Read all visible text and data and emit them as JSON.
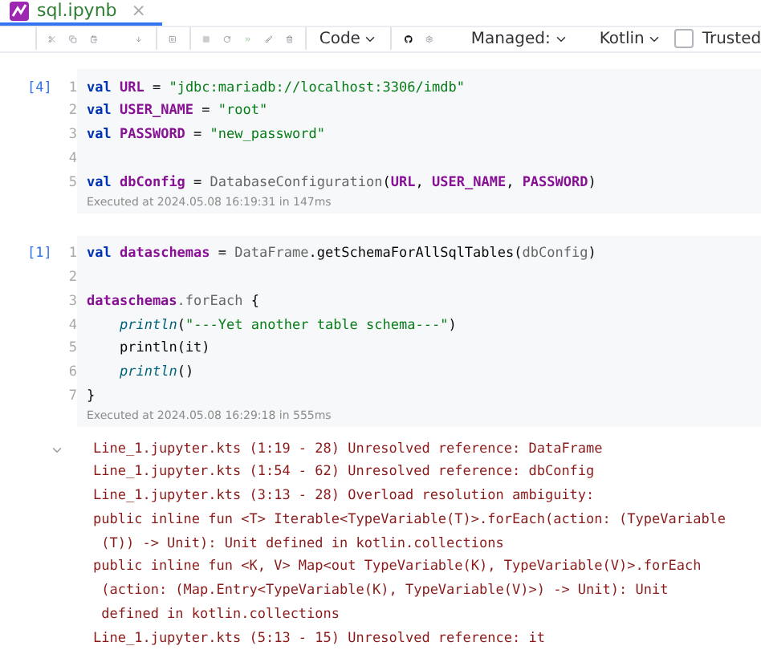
{
  "tabs": [
    {
      "label": "sql.ipynb",
      "close": "×",
      "selected": true
    }
  ],
  "toolbar": {
    "cell_type": "Code",
    "managed": "Managed:",
    "kernel": "Kotlin",
    "trusted": {
      "label": "Trusted",
      "checked": false
    }
  },
  "cells": [
    {
      "count": "[4]",
      "executed": "Executed at 2024.05.08 16:19:31 in 147ms",
      "lines": [
        {
          "number": "1",
          "tokens": [
            {
              "text": "val ",
              "kind": "kw"
            },
            {
              "text": "URL",
              "kind": "var"
            },
            {
              "text": " = ",
              "kind": "plain"
            },
            {
              "text": "\"jdbc:mariadb://localhost:3306/imdb\"",
              "kind": "str"
            }
          ]
        },
        {
          "number": "2",
          "tokens": [
            {
              "text": "val ",
              "kind": "kw"
            },
            {
              "text": "USER_NAME",
              "kind": "var"
            },
            {
              "text": " = ",
              "kind": "plain"
            },
            {
              "text": "\"root\"",
              "kind": "str"
            }
          ]
        },
        {
          "number": "3",
          "tokens": [
            {
              "text": "val ",
              "kind": "kw"
            },
            {
              "text": "PASSWORD",
              "kind": "var"
            },
            {
              "text": " = ",
              "kind": "plain"
            },
            {
              "text": "\"new_password\"",
              "kind": "str"
            }
          ]
        },
        {
          "number": "4"
        },
        {
          "number": "5",
          "tokens": [
            {
              "text": "val ",
              "kind": "kw"
            },
            {
              "text": "dbConfig",
              "kind": "var"
            },
            {
              "text": " = ",
              "kind": "plain"
            },
            {
              "text": "DatabaseConfiguration",
              "kind": "type"
            },
            {
              "text": "(",
              "kind": "plain"
            },
            {
              "text": "URL",
              "kind": "var"
            },
            {
              "text": ", ",
              "kind": "plain"
            },
            {
              "text": "USER_NAME",
              "kind": "var"
            },
            {
              "text": ", ",
              "kind": "plain"
            },
            {
              "text": "PASSWORD",
              "kind": "var"
            },
            {
              "text": ")",
              "kind": "plain"
            }
          ]
        }
      ]
    },
    {
      "count": "[1]",
      "executed": "Executed at 2024.05.08 16:29:18 in 555ms",
      "lines": [
        {
          "number": "1",
          "tokens": [
            {
              "text": "val ",
              "kind": "kw"
            },
            {
              "text": "dataschemas",
              "kind": "var"
            },
            {
              "text": " = ",
              "kind": "plain"
            },
            {
              "text": "DataFrame",
              "kind": "type"
            },
            {
              "text": ".getSchemaForAllSqlTables(",
              "kind": "plain"
            },
            {
              "text": "dbConfig",
              "kind": "type"
            },
            {
              "text": ")",
              "kind": "plain"
            }
          ]
        },
        {
          "number": "2"
        },
        {
          "number": "3",
          "tokens": [
            {
              "text": "dataschemas",
              "kind": "var"
            },
            {
              "text": ".forEach ",
              "kind": "type"
            },
            {
              "text": "{",
              "kind": "plain"
            }
          ]
        },
        {
          "number": "4",
          "indented": true,
          "tokens": [
            {
              "text": "println",
              "kind": "fn"
            },
            {
              "text": "(",
              "kind": "plain"
            },
            {
              "text": "\"---Yet another table schema---\"",
              "kind": "str"
            },
            {
              "text": ")",
              "kind": "plain"
            }
          ]
        },
        {
          "number": "5",
          "indented": true,
          "tokens": [
            {
              "text": "println(it)",
              "kind": "plain"
            }
          ]
        },
        {
          "number": "6",
          "indented": true,
          "tokens": [
            {
              "text": "println",
              "kind": "fn"
            },
            {
              "text": "()",
              "kind": "plain"
            }
          ]
        },
        {
          "number": "7",
          "tokens": [
            {
              "text": "}",
              "kind": "plain"
            }
          ]
        }
      ]
    }
  ],
  "output": {
    "expanded": true,
    "lines": [
      "Line_1.jupyter.kts (1:19 - 28) Unresolved reference: DataFrame",
      "Line_1.jupyter.kts (1:54 - 62) Unresolved reference: dbConfig",
      "Line_1.jupyter.kts (3:13 - 28) Overload resolution ambiguity:",
      "public inline fun <T> Iterable<TypeVariable(T)>.forEach(action: (TypeVariable",
      " (T)) -> Unit): Unit defined in kotlin.collections",
      "public inline fun <K, V> Map<out TypeVariable(K), TypeVariable(V)>.forEach",
      " (action: (Map.Entry<TypeVariable(K), TypeVariable(V)>) -> Unit): Unit",
      " defined in kotlin.collections",
      "Line_1.jupyter.kts (5:13 - 15) Unresolved reference: it"
    ]
  }
}
